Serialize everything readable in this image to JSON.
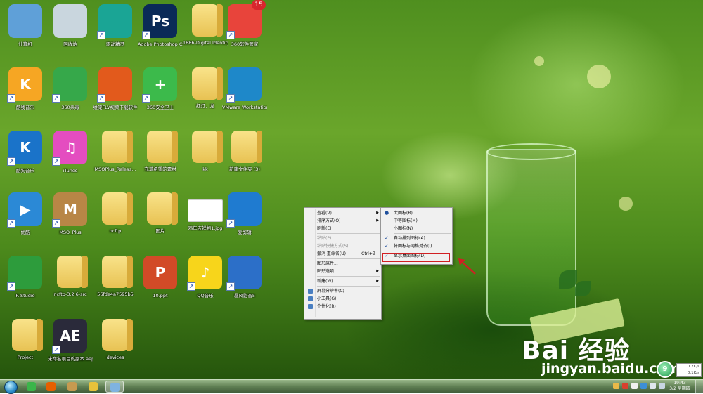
{
  "desktop": {
    "icons": [
      {
        "id": "computer",
        "label": "计算机",
        "glyph": "computer-icon",
        "color": "#5fa0d8",
        "shortcut": false
      },
      {
        "id": "recycle",
        "label": "回收站",
        "glyph": "recycle-bin-icon",
        "color": "#c9d6de",
        "shortcut": false
      },
      {
        "id": "driverelf",
        "label": "驱动精灵",
        "glyph": "drivers-icon",
        "color": "#1aa595",
        "shortcut": true
      },
      {
        "id": "photoshop",
        "label": "Adobe Photoshop CS6",
        "glyph": "photoshop-icon",
        "color": "#0a2a57",
        "text": "Ps",
        "shortcut": true
      },
      {
        "id": "f1886",
        "label": "1886-Digital Identity cs5",
        "glyph": "folder-icon",
        "color": "#f0cd68",
        "shortcut": false
      },
      {
        "id": "soft360",
        "label": "360软件管家",
        "glyph": "software-manager-icon",
        "color": "#e8443b",
        "badge": "15",
        "shortcut": true
      },
      {
        "id": "kuwo",
        "label": "酷我音乐",
        "glyph": "kuwo-music-icon",
        "color": "#f6a623",
        "text": "K",
        "shortcut": true
      },
      {
        "id": "av360",
        "label": "360杀毒",
        "glyph": "antivirus-icon",
        "color": "#36a84a",
        "shortcut": true
      },
      {
        "id": "flvdl",
        "label": "维棠FLV视频下载软件",
        "glyph": "video-downloader-icon",
        "color": "#e25a1c",
        "shortcut": true
      },
      {
        "id": "guard360",
        "label": "360安全卫士",
        "glyph": "security-guard-icon",
        "color": "#3cba4b",
        "text": "+",
        "shortcut": true
      },
      {
        "id": "hongdeng",
        "label": "红灯，龙",
        "glyph": "folder-icon",
        "color": "#f0cd68",
        "shortcut": false
      },
      {
        "id": "vmware",
        "label": "VMware Workstation",
        "glyph": "vmware-icon",
        "color": "#1e88c9",
        "shortcut": true
      },
      {
        "id": "kugou",
        "label": "酷狗音乐",
        "glyph": "kugou-icon",
        "color": "#1a73c9",
        "text": "K",
        "shortcut": true
      },
      {
        "id": "itunes",
        "label": "iTunes",
        "glyph": "itunes-icon",
        "color": "#e44dc0",
        "text": "♫",
        "shortcut": true
      },
      {
        "id": "msoplus_rel",
        "label": "MSOPlus_Releas...",
        "glyph": "folder-icon",
        "color": "#f0cd68",
        "shortcut": false
      },
      {
        "id": "yuanman",
        "label": "充满希望的素材",
        "glyph": "folder-icon",
        "color": "#f0cd68",
        "shortcut": false
      },
      {
        "id": "kk",
        "label": "kk",
        "glyph": "folder-icon",
        "color": "#f0cd68",
        "shortcut": false
      },
      {
        "id": "newfolder3",
        "label": "新建文件夹 (3)",
        "glyph": "folder-icon",
        "color": "#f0cd68",
        "shortcut": false
      },
      {
        "id": "youku",
        "label": "优酷",
        "glyph": "youku-icon",
        "color": "#2b89d6",
        "text": "▶",
        "shortcut": true
      },
      {
        "id": "msoplus",
        "label": "MSO_Plus",
        "glyph": "mso-plus-icon",
        "color": "#b88646",
        "text": "M",
        "shortcut": true
      },
      {
        "id": "ncftp",
        "label": "ncftp",
        "glyph": "folder-icon",
        "color": "#f0cd68",
        "shortcut": false
      },
      {
        "id": "tupian",
        "label": "图片",
        "glyph": "folder-icon",
        "color": "#f0cd68",
        "shortcut": false
      },
      {
        "id": "jpg",
        "label": "鸡年吉祥物1.jpg",
        "glyph": "image-file-icon",
        "color": "#ffffff",
        "shortcut": false
      },
      {
        "id": "jianying",
        "label": "爱剪辑",
        "glyph": "video-editor-icon",
        "color": "#1f7bd0",
        "shortcut": true
      },
      {
        "id": "rstudio",
        "label": "R-Studio",
        "glyph": "r-studio-icon",
        "color": "#2d9c3c",
        "shortcut": true
      },
      {
        "id": "ncftp326",
        "label": "ncftp-3.2.6-src",
        "glyph": "folder-icon",
        "color": "#f0cd68",
        "shortcut": false
      },
      {
        "id": "f56fde",
        "label": "56fde4a7595b5",
        "glyph": "folder-icon",
        "color": "#f0cd68",
        "shortcut": false
      },
      {
        "id": "ppt10",
        "label": "10.ppt",
        "glyph": "ppt-file-icon",
        "color": "#d24a27",
        "text": "P",
        "shortcut": false
      },
      {
        "id": "qqmusic",
        "label": "QQ音乐",
        "glyph": "qq-music-icon",
        "color": "#f7d51b",
        "text": "♪",
        "shortcut": true
      },
      {
        "id": "baofeng",
        "label": "暴风影音5",
        "glyph": "storm-player-icon",
        "color": "#2c6fc8",
        "shortcut": true
      },
      {
        "id": "project",
        "label": "Project",
        "glyph": "folder-icon",
        "color": "#f0cd68",
        "shortcut": false
      },
      {
        "id": "aep",
        "label": "未命名项目的副本.aep",
        "glyph": "after-effects-icon",
        "color": "#2a2a3a",
        "text": "AE",
        "shortcut": true
      },
      {
        "id": "devices",
        "label": "devices",
        "glyph": "folder-icon",
        "color": "#f0cd68",
        "shortcut": false
      }
    ]
  },
  "context_menu": {
    "items": [
      {
        "label": "查看(V)",
        "submenu": true,
        "disabled": false
      },
      {
        "label": "排序方式(O)",
        "submenu": true,
        "disabled": false
      },
      {
        "label": "刷新(E)",
        "submenu": false,
        "disabled": false
      },
      {
        "separator": true
      },
      {
        "label": "粘贴(P)",
        "submenu": false,
        "disabled": true
      },
      {
        "label": "粘贴快捷方式(S)",
        "submenu": false,
        "disabled": true
      },
      {
        "label": "撤消 重命名(U)",
        "shortcut": "Ctrl+Z",
        "submenu": false,
        "disabled": false
      },
      {
        "separator": true
      },
      {
        "label": "图形属性...",
        "submenu": false,
        "disabled": false
      },
      {
        "label": "图形选项",
        "submenu": true,
        "disabled": false
      },
      {
        "separator": true
      },
      {
        "label": "新建(W)",
        "submenu": true,
        "disabled": false
      },
      {
        "separator": true
      },
      {
        "label": "屏幕分辨率(C)",
        "icon": "screen-resolution-icon",
        "submenu": false,
        "disabled": false
      },
      {
        "label": "小工具(G)",
        "icon": "gadgets-icon",
        "submenu": false,
        "disabled": false
      },
      {
        "label": "个性化(R)",
        "icon": "personalize-icon",
        "submenu": false,
        "disabled": false
      }
    ]
  },
  "view_submenu": {
    "items": [
      {
        "label": "大图标(R)",
        "mark": "●"
      },
      {
        "label": "中等图标(M)",
        "mark": ""
      },
      {
        "label": "小图标(N)",
        "mark": ""
      },
      {
        "separator": true
      },
      {
        "label": "自动排列图标(A)",
        "mark": "✓"
      },
      {
        "label": "将图标与网格对齐(I)",
        "mark": "✓"
      },
      {
        "separator": true
      },
      {
        "label": "显示桌面图标(D)",
        "mark": "✓",
        "highlighted": true
      }
    ],
    "highlight_color": "#d11f23"
  },
  "watermark": {
    "brand": "Bai  经验",
    "url": "jingyan.baidu.com"
  },
  "network_monitor": {
    "up": "0.2K/s",
    "down": "0.1K/s",
    "percent": "9"
  },
  "taskbar": {
    "pinned": [
      {
        "name": "360-browser-icon",
        "color": "#3bb54a"
      },
      {
        "name": "firefox-icon",
        "color": "#e66000"
      },
      {
        "name": "mso-plus-icon",
        "color": "#c69a50"
      },
      {
        "name": "app-icon",
        "color": "#e7c23a"
      },
      {
        "name": "explorer-icon",
        "color": "#7fb3e0",
        "active": true
      }
    ],
    "clock": {
      "time": "19:43",
      "date": "3/2 星期四"
    }
  }
}
